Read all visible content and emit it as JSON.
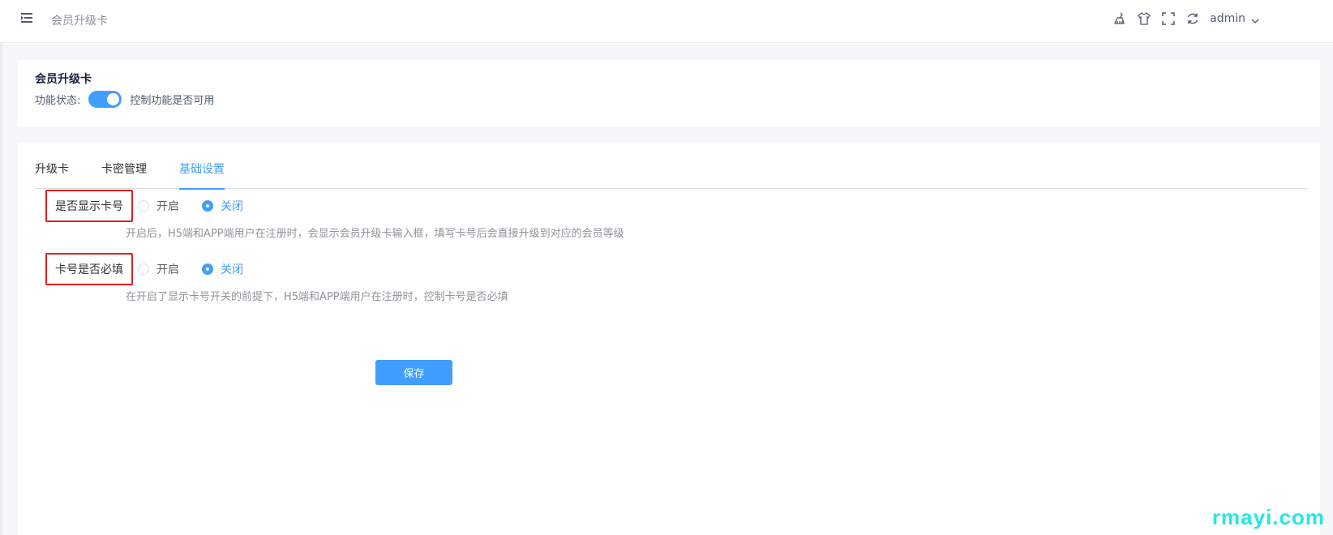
{
  "header": {
    "title": "会员升级卡",
    "username": "admin",
    "icons": [
      "clean-icon",
      "tshirt-icon",
      "fullscreen-icon",
      "refresh-icon",
      "chevron-down-icon"
    ]
  },
  "top_card": {
    "title": "会员升级卡",
    "status_label": "功能状态:",
    "status_hint": "控制功能是否可用",
    "enabled": true
  },
  "tabs": [
    {
      "label": "升级卡",
      "active": false
    },
    {
      "label": "卡密管理",
      "active": false
    },
    {
      "label": "基础设置",
      "active": true
    }
  ],
  "form": {
    "show_card_number": {
      "label": "是否显示卡号",
      "options": [
        "开启",
        "关闭"
      ],
      "selected": "关闭",
      "hint": "开启后，H5端和APP端用户在注册时，会显示会员升级卡输入框，填写卡号后会直接升级到对应的会员等级"
    },
    "card_number_required": {
      "label": "卡号是否必填",
      "options": [
        "开启",
        "关闭"
      ],
      "selected": "关闭",
      "hint": "在开启了显示卡号开关的前提下，H5端和APP端用户在注册时，控制卡号是否必填"
    },
    "save_label": "保存"
  },
  "watermark": "rmayi.com",
  "colors": {
    "primary": "#409eff",
    "highlight_border": "#e02020",
    "watermark": "#25e6e6"
  }
}
